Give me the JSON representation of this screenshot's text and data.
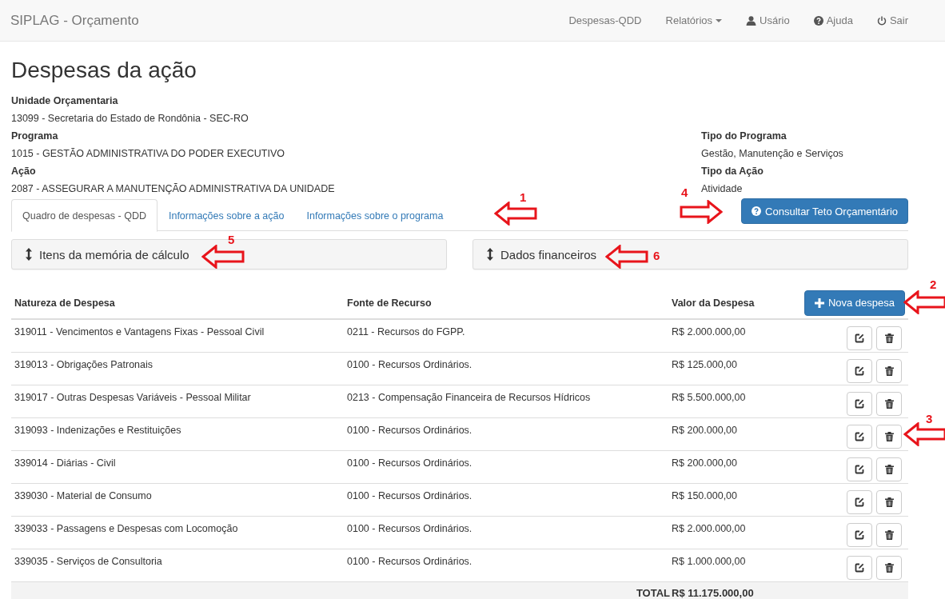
{
  "navbar": {
    "brand": "SIPLAG - Orçamento",
    "items": [
      {
        "label": "Despesas-QDD",
        "kind": "link"
      },
      {
        "label": "Relatórios",
        "kind": "dropdown"
      },
      {
        "label": "Usário",
        "kind": "user"
      },
      {
        "label": "Ajuda",
        "kind": "help"
      },
      {
        "label": "Sair",
        "kind": "power"
      }
    ]
  },
  "page_title": "Despesas da ação",
  "info": [
    {
      "label": "Unidade Orçamentaria",
      "value": "13099 - Secretaria do Estado de Rondônia - SEC-RO"
    },
    {
      "label": "Programa",
      "value": "1015 - GESTÃO ADMINISTRATIVA DO PODER EXECUTIVO",
      "side_label": "Tipo do Programa",
      "side_value": "Gestão, Manutenção e Serviços"
    },
    {
      "label": "Ação",
      "value": "2087 - ASSEGURAR A MANUTENÇÃO ADMINISTRATIVA DA UNIDADE",
      "side_label": "Tipo da Ação",
      "side_value": "Atividade"
    }
  ],
  "tabs": [
    {
      "label": "Quadro de despesas - QDD",
      "selected": true
    },
    {
      "label": "Informações sobre a ação",
      "selected": false
    },
    {
      "label": "Informações sobre o programa",
      "selected": false
    }
  ],
  "consult_button": "Consultar Teto Orçamentário",
  "panels": [
    {
      "title": "Itens da memória de cálculo"
    },
    {
      "title": "Dados financeiros"
    }
  ],
  "table": {
    "columns": [
      "Natureza de Despesa",
      "Fonte de Recurso",
      "Valor da Despesa"
    ],
    "new_button": "Nova despesa",
    "rows": [
      {
        "natureza": "319011 - Vencimentos e Vantagens Fixas - Pessoal Civil",
        "fonte": "0211 - Recursos do FGPP.",
        "valor": "R$ 2.000.000,00"
      },
      {
        "natureza": "319013 - Obrigações Patronais",
        "fonte": "0100 - Recursos Ordinários.",
        "valor": "R$ 125.000,00"
      },
      {
        "natureza": "319017 - Outras Despesas Variáveis - Pessoal Militar",
        "fonte": "0213 - Compensação Financeira de Recursos Hídricos",
        "valor": "R$ 5.500.000,00"
      },
      {
        "natureza": "319093 - Indenizações e Restituições",
        "fonte": "0100 - Recursos Ordinários.",
        "valor": "R$ 200.000,00"
      },
      {
        "natureza": "339014 - Diárias - Civil",
        "fonte": "0100 - Recursos Ordinários.",
        "valor": "R$ 200.000,00"
      },
      {
        "natureza": "339030 - Material de Consumo",
        "fonte": "0100 - Recursos Ordinários.",
        "valor": "R$ 150.000,00"
      },
      {
        "natureza": "339033 - Passagens e Despesas com Locomoção",
        "fonte": "0100 - Recursos Ordinários.",
        "valor": "R$ 2.000.000,00"
      },
      {
        "natureza": "339035 - Serviços de Consultoria",
        "fonte": "0100 - Recursos Ordinários.",
        "valor": "R$ 1.000.000,00"
      }
    ],
    "total_label": "TOTAL",
    "total_value": "R$ 11.175.000,00"
  },
  "callouts": [
    {
      "number": "1",
      "kind": "left"
    },
    {
      "number": "2",
      "kind": "left"
    },
    {
      "number": "3",
      "kind": "left"
    },
    {
      "number": "4",
      "kind": "right"
    },
    {
      "number": "5",
      "kind": "left"
    },
    {
      "number": "6",
      "kind": "left"
    }
  ]
}
